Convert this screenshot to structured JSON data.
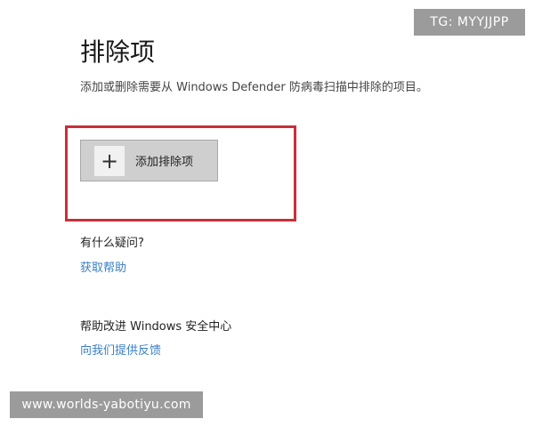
{
  "watermarks": {
    "top": "TG: MYYJJPP",
    "bottom": "www.worlds-yabotiyu.com"
  },
  "page": {
    "title": "排除项",
    "description": "添加或删除需要从 Windows Defender 防病毒扫描中排除的项目。"
  },
  "add_exclusion": {
    "icon": "plus-icon",
    "plus_glyph": "+",
    "label": "添加排除项"
  },
  "help": {
    "heading": "有什么疑问?",
    "link": "获取帮助"
  },
  "improve": {
    "heading": "帮助改进 Windows 安全中心",
    "link": "向我们提供反馈"
  },
  "colors": {
    "highlight": "#c8303a",
    "link": "#3a7fc1",
    "button_bg": "#cfcfcf",
    "watermark_bg": "#9b9b9b"
  }
}
